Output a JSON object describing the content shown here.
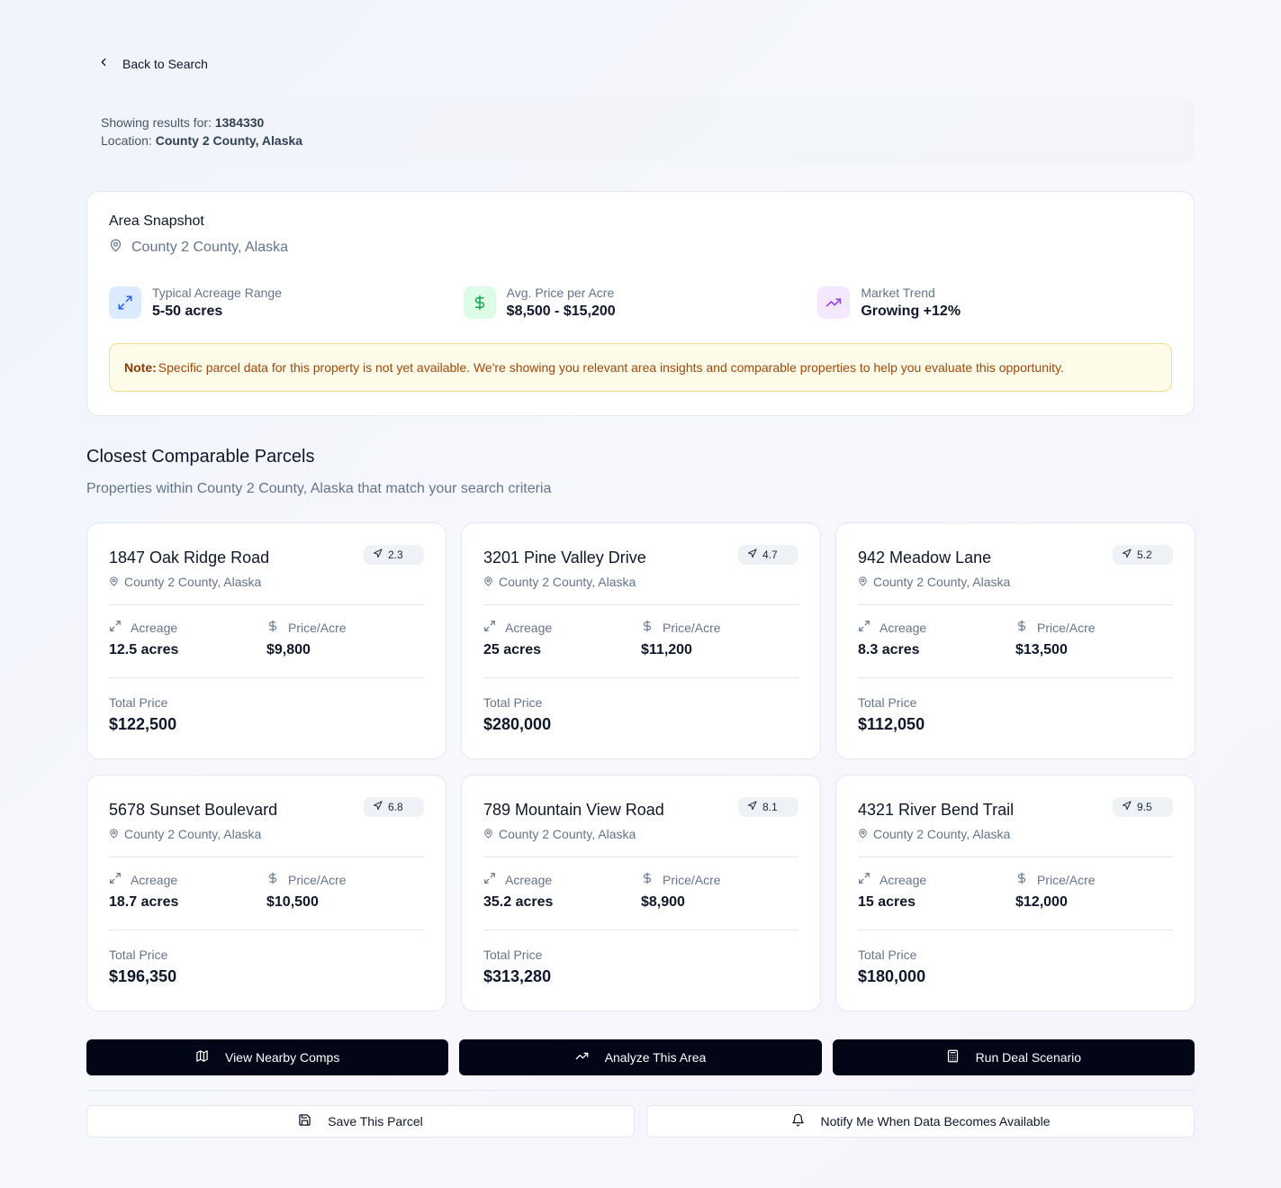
{
  "nav": {
    "back_label": "Back to Search"
  },
  "search": {
    "showing_label": "Showing results for:",
    "query": "1384330",
    "location_label": "Location:",
    "location": "County 2 County, Alaska"
  },
  "snapshot": {
    "title": "Area Snapshot",
    "location": "County 2 County, Alaska",
    "stats": [
      {
        "label": "Typical Acreage Range",
        "value": "5-50 acres",
        "icon": "expand-arrows-icon",
        "color": "#2563eb",
        "bg": "#dbeafe"
      },
      {
        "label": "Avg. Price per Acre",
        "value": "$8,500 - $15,200",
        "icon": "dollar-icon",
        "color": "#16a34a",
        "bg": "#dcfce7"
      },
      {
        "label": "Market Trend",
        "value": "Growing +12%",
        "icon": "trending-up-icon",
        "color": "#9333ea",
        "bg": "#f3e8ff"
      }
    ],
    "note_label": "Note:",
    "note_text": "Specific parcel data for this property is not yet available. We're showing you relevant area insights and comparable properties to help you evaluate this opportunity."
  },
  "comps": {
    "title": "Closest Comparable Parcels",
    "subtitle": "Properties within County 2 County, Alaska that match your search criteria",
    "acreage_label": "Acreage",
    "ppa_label": "Price/Acre",
    "total_label": "Total Price",
    "cards": [
      {
        "address": "1847 Oak Ridge Road",
        "location": "County 2 County, Alaska",
        "distance": "2.3",
        "acreage": "12.5 acres",
        "price_per_acre": "$9,800",
        "total": "$122,500"
      },
      {
        "address": "3201 Pine Valley Drive",
        "location": "County 2 County, Alaska",
        "distance": "4.7",
        "acreage": "25 acres",
        "price_per_acre": "$11,200",
        "total": "$280,000"
      },
      {
        "address": "942 Meadow Lane",
        "location": "County 2 County, Alaska",
        "distance": "5.2",
        "acreage": "8.3 acres",
        "price_per_acre": "$13,500",
        "total": "$112,050"
      },
      {
        "address": "5678 Sunset Boulevard",
        "location": "County 2 County, Alaska",
        "distance": "6.8",
        "acreage": "18.7 acres",
        "price_per_acre": "$10,500",
        "total": "$196,350"
      },
      {
        "address": "789 Mountain View Road",
        "location": "County 2 County, Alaska",
        "distance": "8.1",
        "acreage": "35.2 acres",
        "price_per_acre": "$8,900",
        "total": "$313,280"
      },
      {
        "address": "4321 River Bend Trail",
        "location": "County 2 County, Alaska",
        "distance": "9.5",
        "acreage": "15 acres",
        "price_per_acre": "$12,000",
        "total": "$180,000"
      }
    ]
  },
  "actions": {
    "view_comps": "View Nearby Comps",
    "analyze_area": "Analyze This Area",
    "run_deal": "Run Deal Scenario",
    "save_parcel": "Save This Parcel",
    "notify": "Notify Me When Data Becomes Available"
  }
}
